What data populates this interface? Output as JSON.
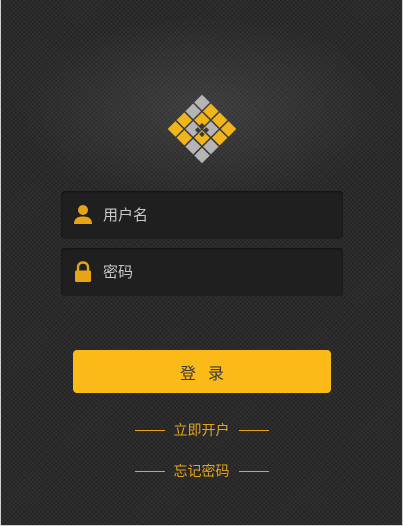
{
  "colors": {
    "accent": "#fbba17",
    "link": "#e6a417",
    "background": "#2a2a2a",
    "field": "#1f1f20"
  },
  "logo": {
    "icon": "diamond-grid-logo-icon"
  },
  "form": {
    "username": {
      "icon": "user-icon",
      "placeholder": "用户名",
      "value": ""
    },
    "password": {
      "icon": "lock-icon",
      "placeholder": "密码",
      "value": ""
    },
    "login_label": "登录"
  },
  "links": {
    "register": "立即开户",
    "forgot_password": "忘记密码"
  }
}
